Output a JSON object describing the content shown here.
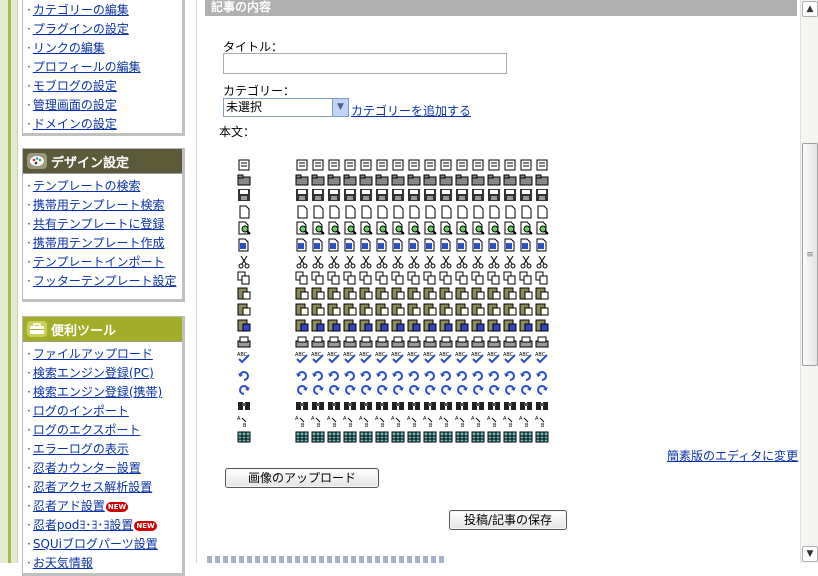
{
  "sidebar": {
    "box1_items": [
      {
        "label": "カテゴリーの編集"
      },
      {
        "label": "プラグインの設定"
      },
      {
        "label": "リンクの編集"
      },
      {
        "label": "プロフィールの編集"
      },
      {
        "label": "モブログの設定"
      },
      {
        "label": "管理画面の設定"
      },
      {
        "label": "ドメインの設定"
      }
    ],
    "design": {
      "title": "デザイン設定",
      "color": "#5b5b3a",
      "items": [
        {
          "label": "テンプレートの検索"
        },
        {
          "label": "携帯用テンプレート検索"
        },
        {
          "label": "共有テンプレートに登録"
        },
        {
          "label": "携帯用テンプレート作成"
        },
        {
          "label": "テンプレートインポート"
        },
        {
          "label": "フッターテンプレート設定"
        }
      ]
    },
    "tools": {
      "title": "便利ツール",
      "color": "#a3ad2a",
      "items": [
        {
          "label": "ファイルアップロード"
        },
        {
          "label": "検索エンジン登録(PC)"
        },
        {
          "label": "検索エンジン登録(携帯)"
        },
        {
          "label": "ログのインポート"
        },
        {
          "label": "ログのエクスポート"
        },
        {
          "label": "エラーログの表示"
        },
        {
          "label": "忍者カウンター設置"
        },
        {
          "label": "忍者アクセス解析設置"
        },
        {
          "label": "忍者アド設置",
          "badge": "NEW"
        },
        {
          "label": "忍者podﾖ･ﾖ･ﾖ設置",
          "badge": "NEW"
        },
        {
          "label": "SQUiブログパーツ設置"
        },
        {
          "label": "お天気情報"
        }
      ]
    }
  },
  "main": {
    "section_title": "記事の内容",
    "title_label": "タイトル：",
    "title_value": "",
    "category_label": "カテゴリー：",
    "category_selected": "未選択",
    "add_category_link": "カテゴリーを追加する",
    "body_label": "本文：",
    "simple_editor_link": "簡素版のエディタに変更",
    "upload_button": "画像のアップロード",
    "save_button": "投稿/記事の保存"
  },
  "toolbar_icons": [
    "template-icon",
    "new-folder-icon",
    "save-icon",
    "new-document-icon",
    "preview-icon",
    "print-preview-icon",
    "cut-icon",
    "copy-icon",
    "paste-icon",
    "paste-text-icon",
    "paste-word-icon",
    "print-icon",
    "spellcheck-icon",
    "undo-icon",
    "redo-icon",
    "find-icon",
    "replace-icon",
    "table-icon"
  ],
  "colors": {
    "link": "#0b33a8",
    "design_header": "#5b5b3a",
    "tools_header": "#a3ad2a",
    "section_header": "#b0b0b0"
  }
}
